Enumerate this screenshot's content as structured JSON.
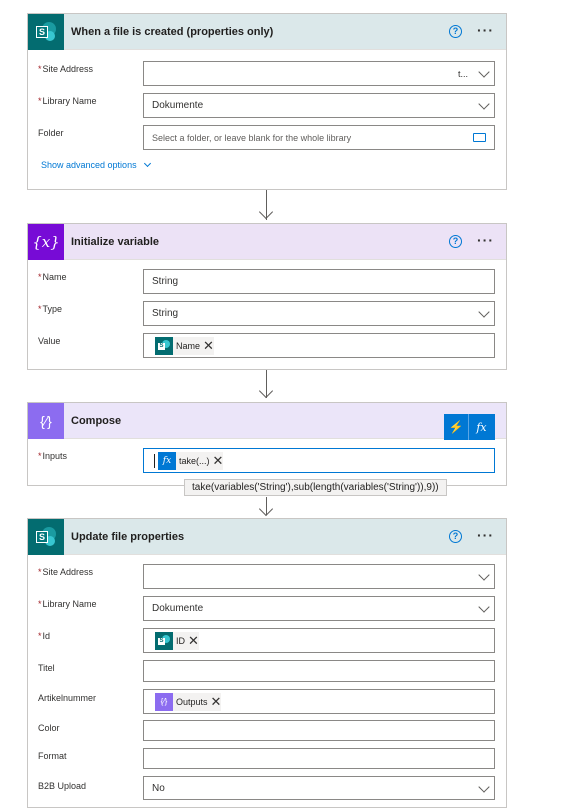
{
  "trigger": {
    "title": "When a file is created (properties only)",
    "site_address_label": "Site Address",
    "site_address_value": "t...",
    "library_label": "Library Name",
    "library_value": "Dokumente",
    "folder_label": "Folder",
    "folder_placeholder": "Select a folder, or leave blank for the whole library",
    "advanced_label": "Show advanced options"
  },
  "init_variable": {
    "title": "Initialize variable",
    "name_label": "Name",
    "name_value": "String",
    "type_label": "Type",
    "type_value": "String",
    "value_label": "Value",
    "value_token": "Name"
  },
  "compose": {
    "title": "Compose",
    "inputs_label": "Inputs",
    "inputs_token": "take(...)",
    "tooltip": "take(variables('String'),sub(length(variables('String')),9))",
    "fx_label": "fx"
  },
  "update": {
    "title": "Update file properties",
    "site_address_label": "Site Address",
    "library_label": "Library Name",
    "library_value": "Dokumente",
    "id_label": "Id",
    "id_token": "ID",
    "titel_label": "Titel",
    "artikel_label": "Artikelnummer",
    "artikel_token": "Outputs",
    "color_label": "Color",
    "format_label": "Format",
    "b2b_label": "B2B Upload",
    "b2b_value": "No"
  },
  "common": {
    "required_mark": "*",
    "help_glyph": "?",
    "more_glyph": "···",
    "remove_glyph": "✕"
  },
  "colors": {
    "sharepoint": "#036c70",
    "variable": "#770bd6",
    "compose": "#8c6cf0",
    "accent": "#0078d4"
  }
}
